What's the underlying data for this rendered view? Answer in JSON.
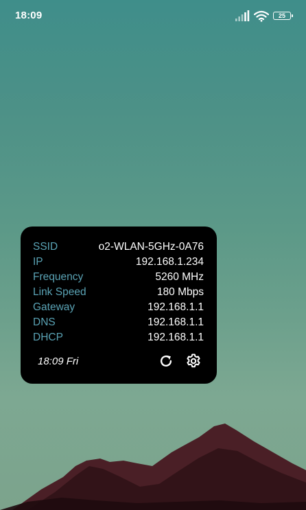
{
  "status_bar": {
    "time": "18:09",
    "battery_level": "25",
    "icons": [
      "signal-icon",
      "wifi-icon",
      "battery-icon"
    ]
  },
  "widget": {
    "rows": [
      {
        "label": "SSID",
        "value": "o2-WLAN-5GHz-0A76"
      },
      {
        "label": "IP",
        "value": "192.168.1.234"
      },
      {
        "label": "Frequency",
        "value": "5260 MHz"
      },
      {
        "label": "Link Speed",
        "value": "180 Mbps"
      },
      {
        "label": "Gateway",
        "value": "192.168.1.1"
      },
      {
        "label": "DNS",
        "value": "192.168.1.1"
      },
      {
        "label": "DHCP",
        "value": "192.168.1.1"
      }
    ],
    "updated": "18:09 Fri",
    "buttons": [
      "refresh-icon",
      "settings-icon"
    ]
  },
  "colors": {
    "label": "#5aa3b5",
    "value": "#ffffff",
    "widget_bg": "#000000",
    "sky_top": "#3f8e8a",
    "sky_bottom": "#7ca38c",
    "mountain": "#4a1f26"
  }
}
